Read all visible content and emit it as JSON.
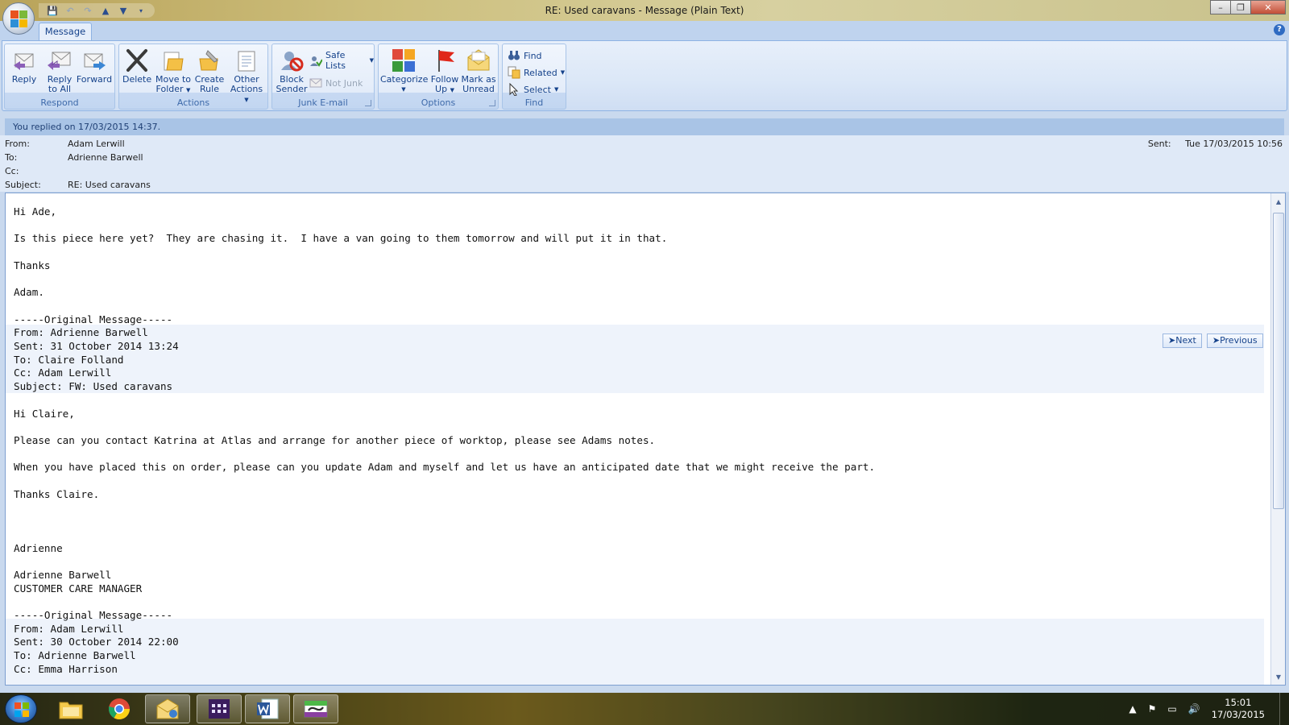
{
  "window": {
    "title": "RE: Used caravans - Message (Plain Text)"
  },
  "tabs": [
    {
      "label": "Message"
    }
  ],
  "ribbon": {
    "respond": {
      "label": "Respond",
      "reply": "Reply",
      "reply_all_1": "Reply",
      "reply_all_2": "to All",
      "forward": "Forward"
    },
    "actions": {
      "label": "Actions",
      "delete": "Delete",
      "move_1": "Move to",
      "move_2": "Folder",
      "rule_1": "Create",
      "rule_2": "Rule",
      "other_1": "Other",
      "other_2": "Actions"
    },
    "junk": {
      "label": "Junk E-mail",
      "block_1": "Block",
      "block_2": "Sender",
      "safe_lists": "Safe Lists",
      "not_junk": "Not Junk"
    },
    "options": {
      "label": "Options",
      "categorize": "Categorize",
      "follow_1": "Follow",
      "follow_2": "Up",
      "mark_1": "Mark as",
      "mark_2": "Unread"
    },
    "find": {
      "label": "Find",
      "find": "Find",
      "related": "Related",
      "select": "Select"
    }
  },
  "infobar": "You replied on 17/03/2015 14:37.",
  "header": {
    "from_label": "From:",
    "from": "Adam Lerwill",
    "to_label": "To:",
    "to": "Adrienne Barwell",
    "cc_label": "Cc:",
    "cc": "",
    "subject_label": "Subject:",
    "subject": "RE: Used caravans",
    "sent_label": "Sent:",
    "sent": "Tue 17/03/2015 10:56"
  },
  "body_lines": [
    "Hi Ade,",
    "",
    "Is this piece here yet?  They are chasing it.  I have a van going to them tomorrow and will put it in that.",
    "",
    "Thanks",
    "",
    "Adam.",
    "",
    "-----Original Message-----",
    "From: Adrienne Barwell",
    "Sent: 31 October 2014 13:24",
    "To: Claire Folland",
    "Cc: Adam Lerwill",
    "Subject: FW: Used caravans",
    "",
    "Hi Claire,",
    "",
    "Please can you contact Katrina at Atlas and arrange for another piece of worktop, please see Adams notes.",
    "",
    "When you have placed this on order, please can you update Adam and myself and let us have an anticipated date that we might receive the part.",
    "",
    "Thanks Claire.",
    "",
    "",
    "",
    "Adrienne",
    "",
    "Adrienne Barwell",
    "CUSTOMER CARE MANAGER",
    "",
    "-----Original Message-----",
    "From: Adam Lerwill",
    "Sent: 30 October 2014 22:00",
    "To: Adrienne Barwell",
    "Cc: Emma Harrison"
  ],
  "nav": {
    "next": "Next",
    "previous": "Previous"
  },
  "taskbar": {
    "apps": [
      "file-explorer-icon",
      "chrome-icon",
      "outlook-icon",
      "calendar-app-icon",
      "word-icon",
      "sage-icon"
    ],
    "time": "15:01",
    "date": "17/03/2015"
  },
  "colors": {
    "ribbon_text": "#15428b",
    "infobar_bg": "#a9c4e6",
    "header_bg": "#dfe9f7"
  }
}
